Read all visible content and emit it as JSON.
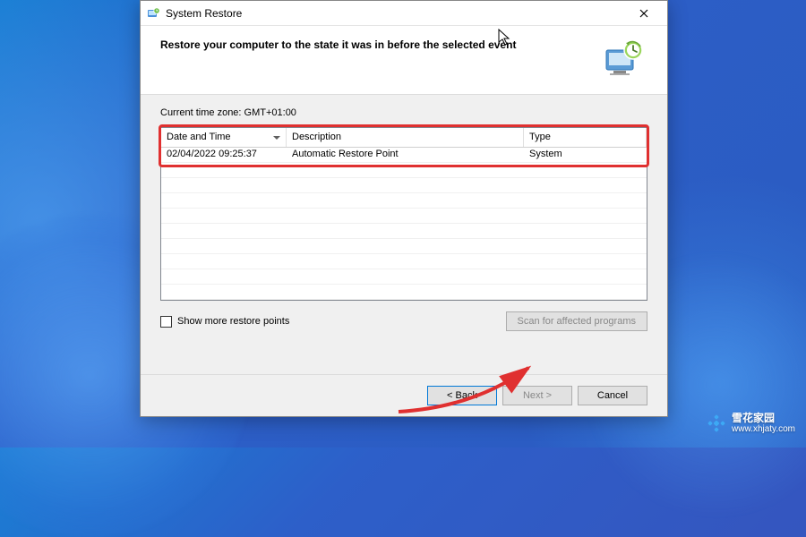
{
  "window": {
    "title": "System Restore",
    "header": "Restore your computer to the state it was in before the selected event"
  },
  "timezone": "Current time zone: GMT+01:00",
  "columns": {
    "datetime": "Date and Time",
    "description": "Description",
    "type": "Type"
  },
  "rows": [
    {
      "datetime": "02/04/2022 09:25:37",
      "description": "Automatic Restore Point",
      "type": "System"
    }
  ],
  "checkbox_label": "Show more restore points",
  "scan_button": "Scan for affected programs",
  "footer": {
    "back": "< Back",
    "next": "Next >",
    "cancel": "Cancel"
  },
  "watermark": {
    "brand": "雪花家园",
    "url": "www.xhjaty.com"
  }
}
